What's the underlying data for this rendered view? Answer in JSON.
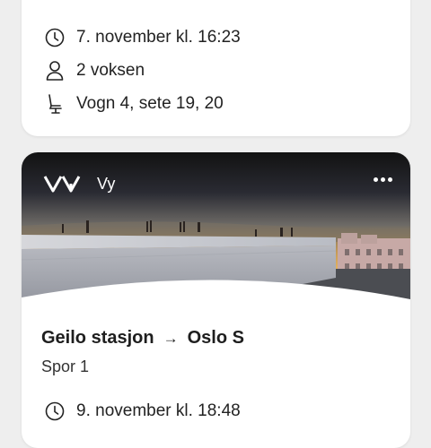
{
  "top_card": {
    "time": "7. november kl. 16:23",
    "passengers": "2 voksen",
    "seats": "Vogn 4, sete 19, 20"
  },
  "trip_card": {
    "logo_text": "VY",
    "operator": "Vy",
    "from": "Geilo stasjon",
    "arrow": "→",
    "to": "Oslo S",
    "track": "Spor 1",
    "time": "9. november kl. 18:48"
  },
  "icons": {
    "time": "clock-icon",
    "passengers": "person-icon",
    "seat": "seat-icon",
    "menu": "more-icon"
  },
  "colors": {
    "background": "#eeeeee",
    "card": "#ffffff",
    "text": "#1e1e1e"
  }
}
